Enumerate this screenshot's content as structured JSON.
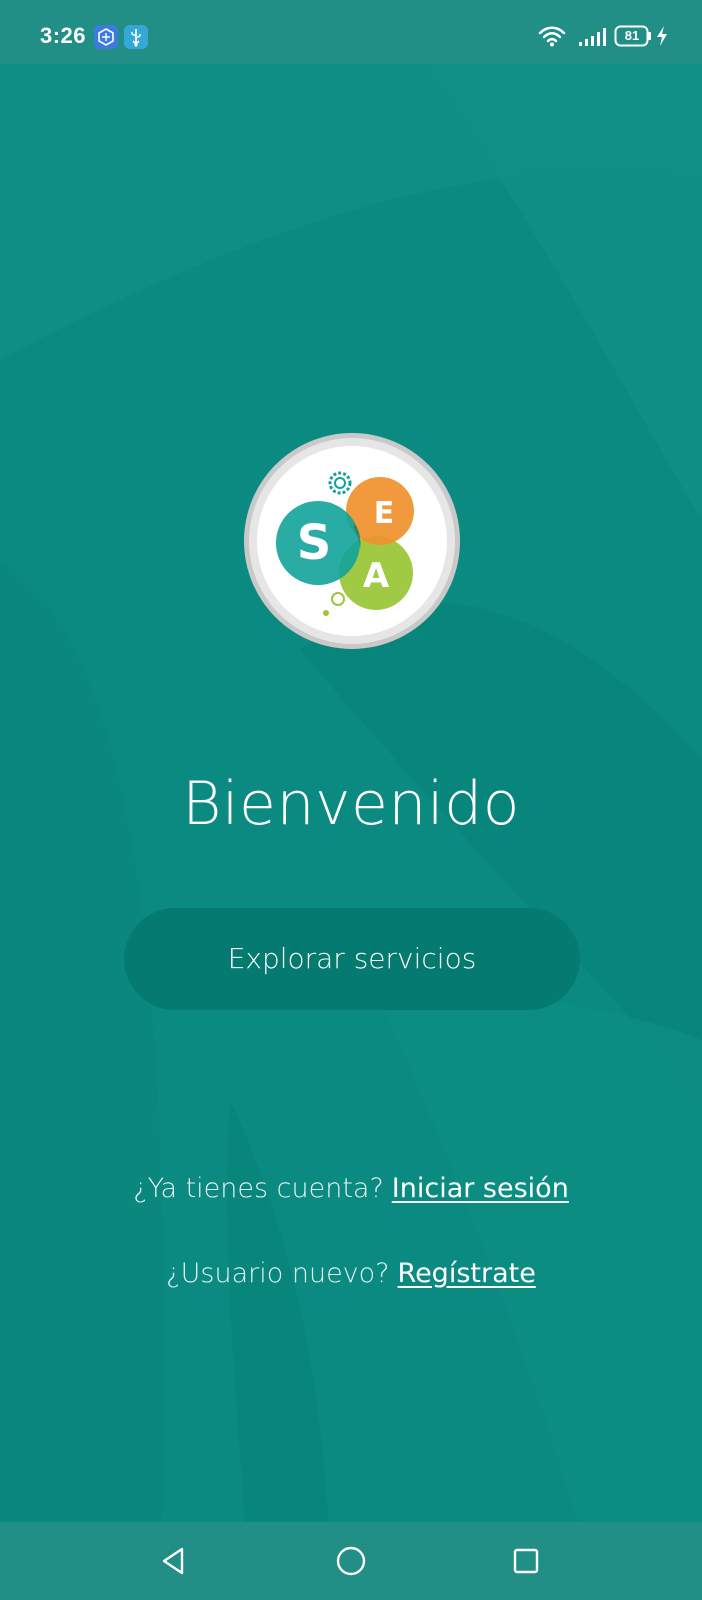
{
  "status_bar": {
    "time": "3:26",
    "app_icons": [
      "vpn-shield-icon",
      "usb-icon"
    ],
    "wifi_icon": "wifi-icon",
    "signal_icon": "cellular-signal-icon",
    "battery_level": "81",
    "charging_icon": "charging-bolt-icon"
  },
  "logo": {
    "letters": [
      "S",
      "E",
      "A"
    ],
    "colors": {
      "s_circle": "#12a39a",
      "e_circle": "#f0912c",
      "a_circle": "#9cc73a",
      "ring": "#d4d4d4"
    }
  },
  "welcome": {
    "title": "Bienvenido",
    "explore_button": "Explorar servicios"
  },
  "auth": {
    "login_prompt": "¿Ya tienes cuenta?",
    "login_link": "Iniciar sesión",
    "register_prompt": "¿Usuario nuevo?",
    "register_link": "Regístrate"
  },
  "nav_bar": {
    "buttons": [
      "back-icon",
      "home-icon",
      "recent-apps-icon"
    ]
  },
  "theme": {
    "background": "#0a8a80",
    "status_bar": "#218f86",
    "button": "#057a70",
    "text": "#ffffff"
  }
}
